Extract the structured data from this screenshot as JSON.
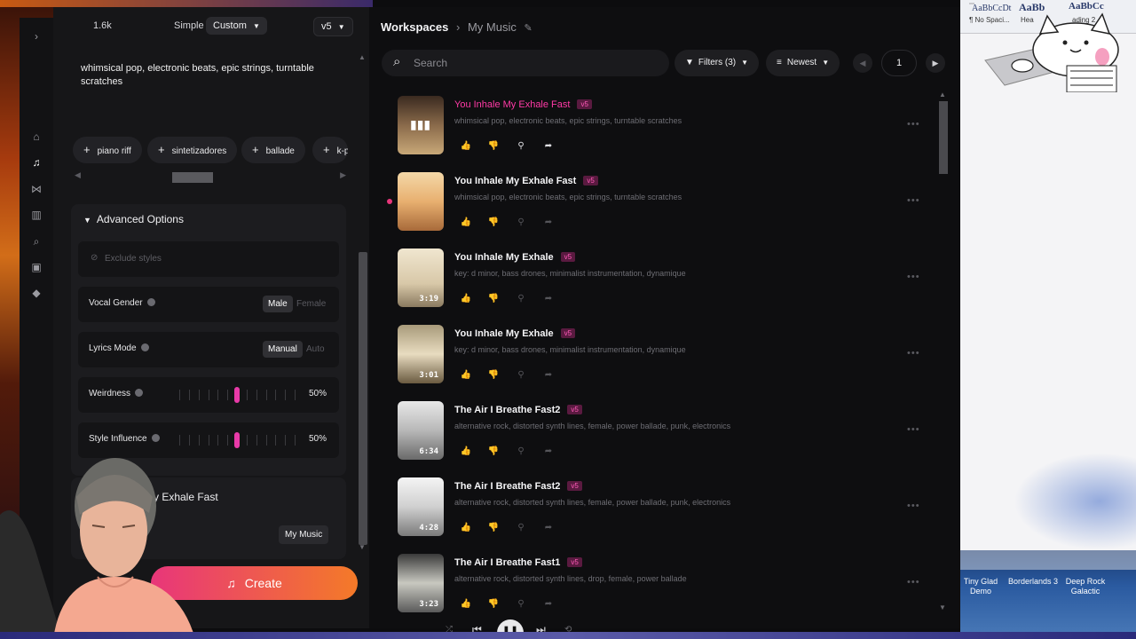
{
  "create_panel": {
    "credits": "1.6k",
    "mode_simple": "Simple",
    "mode_custom": "Custom",
    "model": "v5",
    "styles_text": "whimsical pop, electronic beats, epic strings, turntable scratches",
    "tags": [
      "piano riff",
      "sintetizadores",
      "ballade",
      "k-p"
    ],
    "advanced_label": "Advanced Options",
    "exclude_placeholder": "Exclude styles",
    "vocal_gender_label": "Vocal Gender",
    "vocal_male": "Male",
    "vocal_female": "Female",
    "lyrics_mode_label": "Lyrics Mode",
    "lyrics_manual": "Manual",
    "lyrics_auto": "Auto",
    "weirdness_label": "Weirdness",
    "weirdness_value": "50%",
    "weirdness_level": 0.5,
    "style_influence_label": "Style Influence",
    "style_influence_value": "50%",
    "style_influence_level": 0.5,
    "song_title": "My Exhale Fast",
    "workspace_label": "My Music",
    "create_label": "Create"
  },
  "workspace": {
    "breadcrumb_root": "Workspaces",
    "breadcrumb_current": "My Music",
    "search_placeholder": "Search",
    "filters_label": "Filters (3)",
    "sort_label": "Newest",
    "page": "1"
  },
  "songs": [
    {
      "title": "You Inhale My Exhale Fast",
      "version": "v5",
      "desc": "whimsical pop, electronic beats, epic strings, turntable scratches",
      "duration": "",
      "playing": true
    },
    {
      "title": "You Inhale My Exhale Fast",
      "version": "v5",
      "desc": "whimsical pop, electronic beats, epic strings, turntable scratches",
      "duration": "",
      "playing": false
    },
    {
      "title": "You Inhale My Exhale",
      "version": "v5",
      "desc": "key: d minor, bass drones, minimalist instrumentation, dynamique",
      "duration": "3:19",
      "playing": false
    },
    {
      "title": "You Inhale My Exhale",
      "version": "v5",
      "desc": "key: d minor, bass drones, minimalist instrumentation, dynamique",
      "duration": "3:01",
      "playing": false
    },
    {
      "title": "The Air I Breathe Fast2",
      "version": "v5",
      "desc": "alternative rock, distorted synth lines, female, power ballade, punk, electronics",
      "duration": "6:34",
      "playing": false
    },
    {
      "title": "The Air I Breathe Fast2",
      "version": "v5",
      "desc": "alternative rock, distorted synth lines, female, power ballade, punk, electronics",
      "duration": "4:28",
      "playing": false
    },
    {
      "title": "The Air I Breathe Fast1",
      "version": "v5",
      "desc": "alternative rock, distorted synth lines, drop, female, power ballade",
      "duration": "3:23",
      "playing": false
    }
  ],
  "desktop": {
    "word_style_1": "AaBbCcDt",
    "word_style_1_name": "¶ No Spaci...",
    "word_style_2": "AaBb",
    "word_style_2_name": "Hea",
    "word_style_3": "AaBbCc",
    "word_style_3_name": "ading 2",
    "taskbar_items": [
      "Tiny Glad Demo",
      "Borderlands 3",
      "Deep Rock Galactic"
    ]
  },
  "colors": {
    "accent_pink": "#ff3aa6",
    "create_gradient_start": "#e8367a",
    "create_gradient_end": "#f47a28"
  }
}
